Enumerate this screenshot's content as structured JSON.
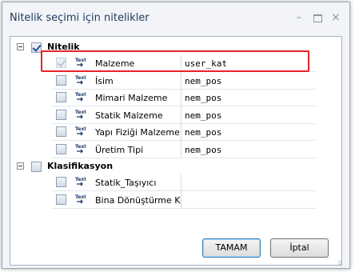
{
  "window": {
    "title": "Nitelik seçimi için nitelikler",
    "controls": {
      "minimize": "–",
      "close": "×"
    }
  },
  "tree": {
    "groups": [
      {
        "label": "Nitelik",
        "checked": true,
        "items": [
          {
            "name": "Malzeme",
            "value": "user_kat",
            "checked": true,
            "disabled": true,
            "highlighted": true
          },
          {
            "name": "İsim",
            "value": "nem_pos",
            "checked": false
          },
          {
            "name": "Mimari Malzeme",
            "value": "nem_pos",
            "checked": false
          },
          {
            "name": "Statik Malzeme",
            "value": "nem_pos",
            "checked": false
          },
          {
            "name": "Yapı Fiziği Malzeme",
            "value": "nem_pos",
            "checked": false
          },
          {
            "name": "Üretim Tipi",
            "value": "nem_pos",
            "checked": false
          }
        ]
      },
      {
        "label": "Klasifikasyon",
        "checked": false,
        "items": [
          {
            "name": "Statik_Taşıyıcı",
            "value": "",
            "checked": false
          },
          {
            "name": "Bina Dönüştürme Ka",
            "value": "",
            "checked": false
          }
        ]
      }
    ],
    "item_icon": "text-attribute-icon",
    "highlight_color": "#e8222a"
  },
  "buttons": {
    "ok_label": "TAMAM",
    "cancel_label": "İptal"
  }
}
